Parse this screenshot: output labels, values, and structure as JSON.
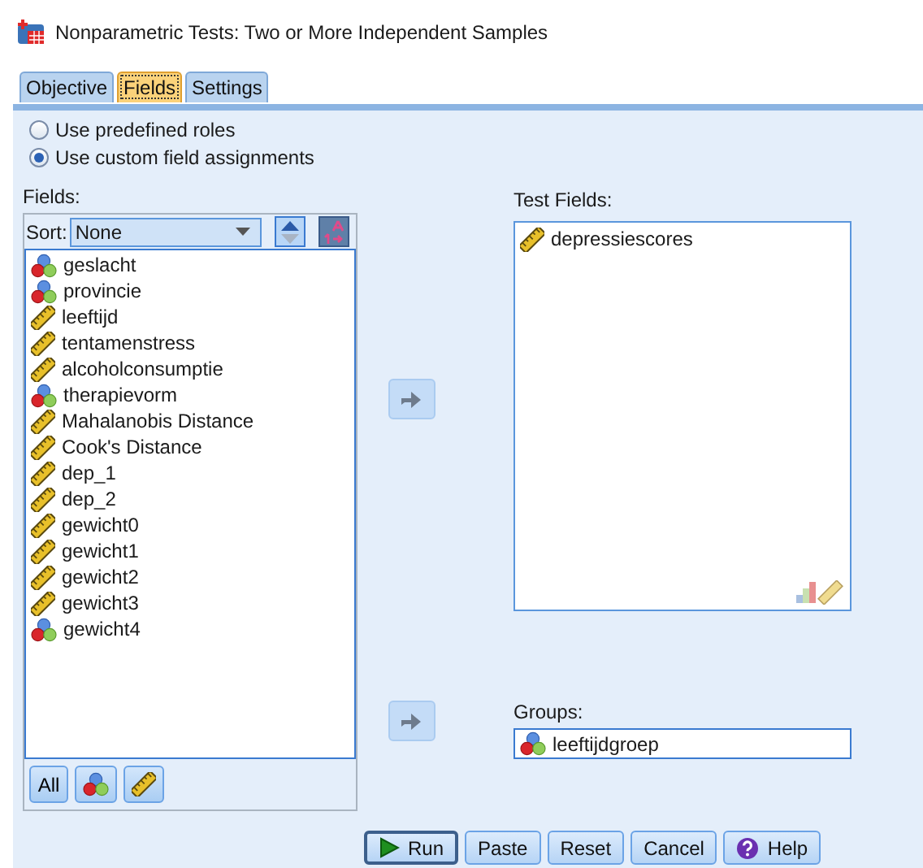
{
  "window": {
    "title": "Nonparametric Tests: Two or More Independent Samples"
  },
  "tabs": [
    {
      "label": "Objective",
      "selected": false
    },
    {
      "label": "Fields",
      "selected": true
    },
    {
      "label": "Settings",
      "selected": false
    }
  ],
  "role_options": [
    {
      "label": "Use predefined roles",
      "selected": false
    },
    {
      "label": "Use custom field assignments",
      "selected": true
    }
  ],
  "fields": {
    "label": "Fields:",
    "sort_label": "Sort:",
    "sort_value": "None",
    "items": [
      {
        "name": "geslacht",
        "kind": "nominal"
      },
      {
        "name": "provincie",
        "kind": "nominal"
      },
      {
        "name": "leeftijd",
        "kind": "scale"
      },
      {
        "name": "tentamenstress",
        "kind": "scale"
      },
      {
        "name": "alcoholconsumptie",
        "kind": "scale"
      },
      {
        "name": "therapievorm",
        "kind": "nominal"
      },
      {
        "name": "Mahalanobis Distance",
        "kind": "scale"
      },
      {
        "name": "Cook's Distance",
        "kind": "scale"
      },
      {
        "name": "dep_1",
        "kind": "scale"
      },
      {
        "name": "dep_2",
        "kind": "scale"
      },
      {
        "name": "gewicht0",
        "kind": "scale"
      },
      {
        "name": "gewicht1",
        "kind": "scale"
      },
      {
        "name": "gewicht2",
        "kind": "scale"
      },
      {
        "name": "gewicht3",
        "kind": "scale"
      },
      {
        "name": "gewicht4",
        "kind": "nominal"
      }
    ],
    "filter_buttons": [
      {
        "kind": "text",
        "label": "All"
      },
      {
        "kind": "nominal"
      },
      {
        "kind": "scale"
      }
    ]
  },
  "test_fields": {
    "label": "Test Fields:",
    "items": [
      {
        "name": "depressiescores",
        "kind": "scale"
      }
    ]
  },
  "groups": {
    "label": "Groups:",
    "items": [
      {
        "name": "leeftijdgroep",
        "kind": "nominal"
      }
    ]
  },
  "buttons": [
    {
      "label": "Run",
      "kind": "play",
      "default": true
    },
    {
      "label": "Paste",
      "kind": "plain",
      "default": false
    },
    {
      "label": "Reset",
      "kind": "plain",
      "default": false
    },
    {
      "label": "Cancel",
      "kind": "plain",
      "default": false
    },
    {
      "label": "Help",
      "kind": "help",
      "default": false
    }
  ]
}
